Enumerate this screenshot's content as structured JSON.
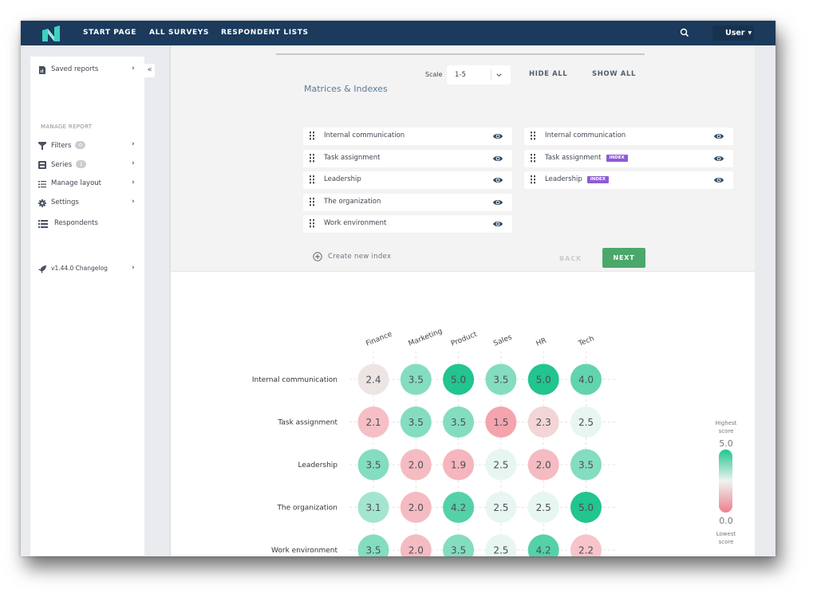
{
  "nav": {
    "logo": "app-logo",
    "items": [
      "START PAGE",
      "ALL SURVEYS",
      "RESPONDENT LISTS"
    ],
    "search_icon": "search-icon",
    "user_label": "User"
  },
  "sidebar": {
    "saved_reports": "Saved reports",
    "section_heading": "MANAGE REPORT",
    "items": [
      {
        "label": "Filters",
        "badge": "0",
        "icon": "filter-icon"
      },
      {
        "label": "Series",
        "badge": "1",
        "icon": "series-icon"
      },
      {
        "label": "Manage layout",
        "icon": "layout-list-icon"
      },
      {
        "label": "Settings",
        "icon": "gear-icon"
      },
      {
        "label": "Respondents",
        "icon": "respondents-list-icon"
      }
    ],
    "changelog": "v1.44.0 Changelog",
    "collapse": "«"
  },
  "config": {
    "scale_label": "Scale",
    "scale_value": "1-5",
    "hide_all": "HIDE ALL",
    "show_all": "SHOW ALL",
    "section_title": "Matrices & Indexes",
    "matrices": [
      "Internal communication",
      "Task assignment",
      "Leadership",
      "The organization",
      "Work environment"
    ],
    "indexes": [
      {
        "name": "Internal communication",
        "tag": ""
      },
      {
        "name": "Task assignment",
        "tag": "INDEX"
      },
      {
        "name": "Leadership",
        "tag": "INDEX"
      }
    ],
    "create_index": "Create new index",
    "back": "BACK",
    "next": "NEXT"
  },
  "chart_data": {
    "type": "heatmap",
    "title": "",
    "columns": [
      "Finance",
      "Marketing",
      "Product",
      "Sales",
      "HR",
      "Tech"
    ],
    "rows": [
      "Internal communication",
      "Task assignment",
      "Leadership",
      "The organization",
      "Work environment"
    ],
    "values": [
      [
        2.4,
        3.5,
        5.0,
        3.5,
        5.0,
        4.0
      ],
      [
        2.1,
        3.5,
        3.5,
        1.5,
        2.3,
        2.5
      ],
      [
        3.5,
        2.0,
        1.9,
        2.5,
        2.0,
        3.5
      ],
      [
        3.1,
        2.0,
        4.2,
        2.5,
        2.5,
        5.0
      ],
      [
        3.5,
        2.0,
        3.5,
        2.5,
        4.2,
        2.2
      ]
    ],
    "scale": [
      0.0,
      5.0
    ],
    "grid": true,
    "colors": {
      "high": "#22c48f",
      "mid": "#e8f6f1",
      "low": "#ef7f8c"
    },
    "legend": {
      "position": "right",
      "high_label": "Highest score",
      "high_value": "5.0",
      "low_label": "Lowest score",
      "low_value": "0.0"
    }
  }
}
